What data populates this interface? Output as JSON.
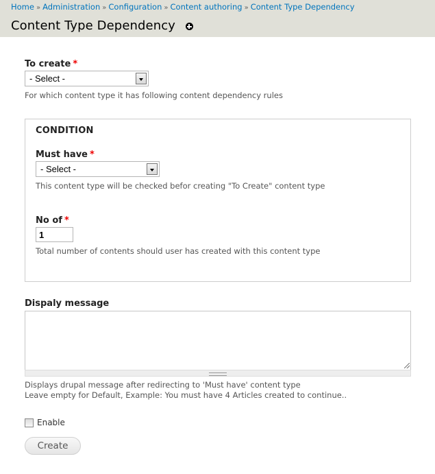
{
  "header": {
    "breadcrumb": [
      {
        "label": "Home"
      },
      {
        "label": "Administration"
      },
      {
        "label": "Configuration"
      },
      {
        "label": "Content authoring"
      },
      {
        "label": "Content Type Dependency"
      }
    ],
    "separator": "»",
    "title": "Content Type Dependency",
    "shortcut_icon": "add-shortcut-icon"
  },
  "form": {
    "to_create": {
      "label": "To create",
      "required_mark": "*",
      "selected": "- Select -",
      "description": "For which content type it has following content dependency rules"
    },
    "condition": {
      "legend": "CONDITION",
      "must_have": {
        "label": "Must have",
        "required_mark": "*",
        "selected": "- Select -",
        "description": "This content type will be checked befor creating \"To Create\" content type"
      },
      "no_of": {
        "label": "No of",
        "required_mark": "*",
        "value": "1",
        "description": "Total number of contents should user has created with this content type"
      }
    },
    "display_message": {
      "label": "Dispaly message",
      "value": "",
      "description_line1": "Displays drupal message after redirecting to 'Must have' content type",
      "description_line2": "Leave empty for Default, Example: You must have 4 Articles created to continue.."
    },
    "enable": {
      "label": "Enable",
      "checked": false
    },
    "submit_label": "Create"
  }
}
